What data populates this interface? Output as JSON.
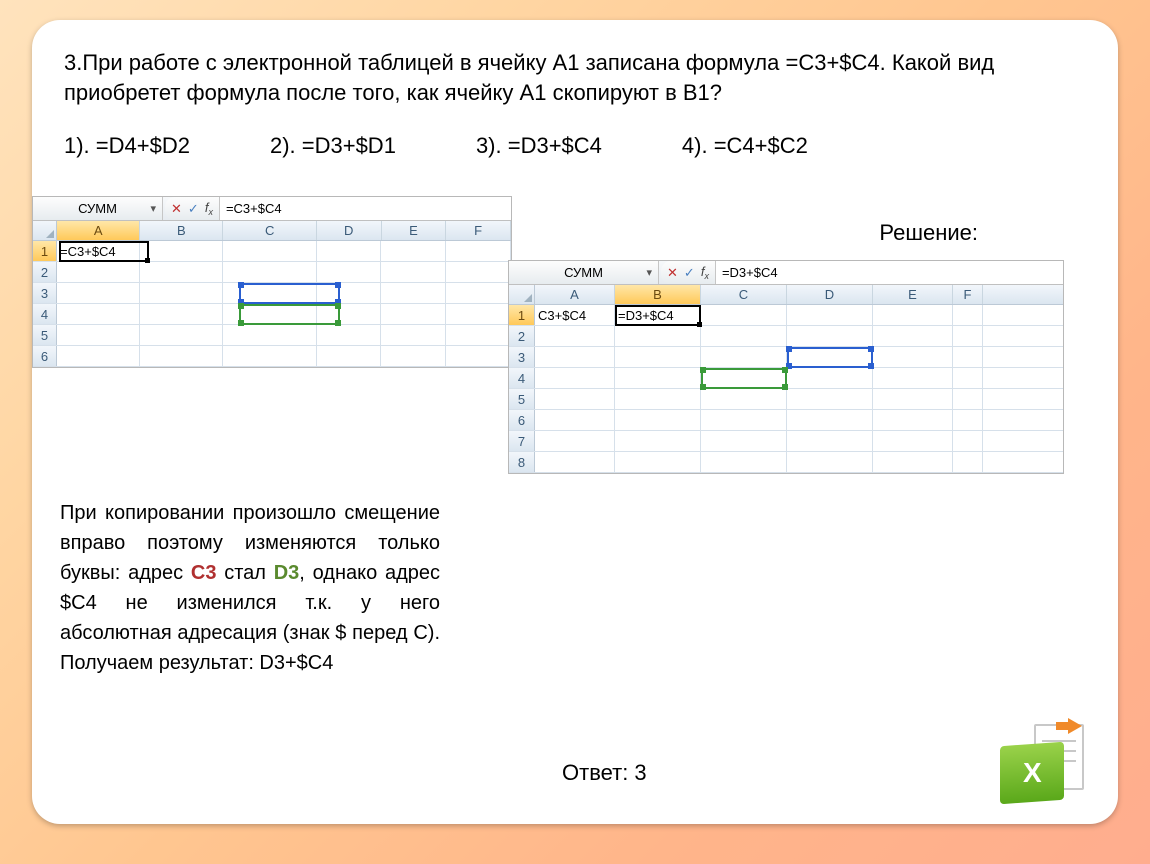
{
  "question": "3.При работе с электронной таблицей в ячейку А1 записана формула =C3+$C4. Какой вид приобретет формула после того, как  ячейку А1 скопируют в В1?",
  "options": {
    "o1": "1). =D4+$D2",
    "o2": "2). =D3+$D1",
    "o3": "3). =D3+$C4",
    "o4": "4). =C4+$C2"
  },
  "solution_label": "Решение:",
  "answer": "Ответ: 3",
  "explanation": {
    "p1": "При копировании произошло смещение вправо поэтому изменяются только буквы: адрес ",
    "c3": "С3",
    "p2": " стал ",
    "d3": "D3",
    "p3": ", однако адрес $C4 не изменился т.к. у него абсолютная адресация (знак $ перед С). Получаем результат: D3+$C4"
  },
  "excel1": {
    "namebox": "СУММ",
    "formula": "=C3+$C4",
    "cols": [
      "A",
      "B",
      "C",
      "D",
      "E",
      "F"
    ],
    "a1": "=C3+$C4",
    "rows": [
      "1",
      "2",
      "3",
      "4",
      "5",
      "6"
    ],
    "active_col": "A",
    "active_row": "1"
  },
  "excel2": {
    "namebox": "СУММ",
    "formula": "=D3+$C4",
    "cols": [
      "A",
      "B",
      "C",
      "D",
      "E",
      "F"
    ],
    "a1": "C3+$C4",
    "b1": "=D3+$C4",
    "rows": [
      "1",
      "2",
      "3",
      "4",
      "5",
      "6",
      "7",
      "8"
    ],
    "active_col": "B",
    "active_row": "1"
  }
}
